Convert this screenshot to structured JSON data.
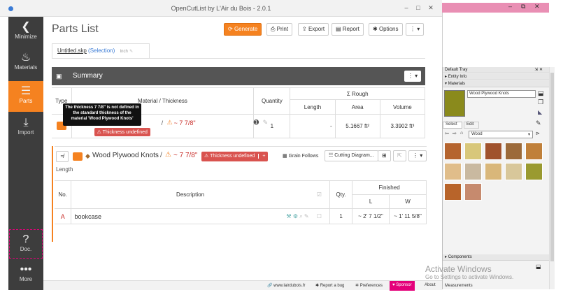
{
  "window": {
    "title": "OpenCutList by L'Air du Bois - 2.0.1",
    "min": "–",
    "max": "□",
    "close": "✕"
  },
  "sidebar": {
    "minimize": "Minimize",
    "materials": "Materials",
    "parts": "Parts",
    "import": "Import",
    "doc": "Doc.",
    "more": "More"
  },
  "header": {
    "title": "Parts List",
    "generate": "Generate",
    "print": "Print",
    "export": "Export",
    "report": "Report",
    "options": "Options"
  },
  "file_tab": {
    "name": "Untitled.skp",
    "selection": "(Selection)",
    "unit": "Inch"
  },
  "summary": {
    "title": "Summary",
    "col_type": "Type",
    "col_material": "Material / Thickness",
    "col_quantity": "Quantity",
    "col_rough": "Σ Rough",
    "col_length": "Length",
    "col_area": "Area",
    "col_volume": "Volume",
    "row": {
      "thickness": "~ 7 7/8\"",
      "badge": "Thickness undefined",
      "quantity": "1",
      "length": "-",
      "area": "5.1667 ft²",
      "volume": "3.3902 ft³"
    }
  },
  "tooltip": "The thickness 7 7/8\" is not defined in the standard thickness of the material 'Wood Plywood Knots'",
  "group": {
    "material": "Wood Plywood Knots",
    "thickness": "~ 7 7/8\"",
    "badge": "Thickness undefined",
    "grain": "Grain Follows",
    "cutting": "Cutting Diagram...",
    "length_label": "Length",
    "col_no": "No.",
    "col_desc": "Description",
    "col_qty": "Qty.",
    "col_finished": "Finished",
    "col_l": "L",
    "col_w": "W",
    "row": {
      "no": "A",
      "desc": "bookcase",
      "qty": "1",
      "l": "~ 2' 7 1/2\"",
      "w": "~ 1' 11 5/8\""
    }
  },
  "footer": {
    "site": "www.lairdubois.fr",
    "bug": "Report a bug",
    "prefs": "Preferences",
    "sponsor": "Sponsor",
    "about": "About"
  },
  "tray": {
    "title": "Default Tray",
    "entity_info": "Entity Info",
    "materials": "Materials",
    "material_name": "Wood Plywood Knots",
    "select": "Select",
    "edit": "Edit",
    "category": "Wood",
    "components": "Components",
    "measurements": "Measurements"
  },
  "watermark": {
    "line1": "Activate Windows",
    "line2": "Go to Settings to activate Windows."
  },
  "colors": {
    "accent": "#f58220",
    "danger": "#d9534f",
    "sidebar": "#3d3d3d",
    "sponsor": "#e4007a",
    "swatches": [
      "#b5642e",
      "#d8c77a",
      "#a0522d",
      "#9c6a3a",
      "#c0803a",
      "#e0bd8a",
      "#c9b9a0",
      "#d9b77a",
      "#d8c79a",
      "#9a9a30",
      "#b8642a",
      "#c68a6e"
    ]
  }
}
